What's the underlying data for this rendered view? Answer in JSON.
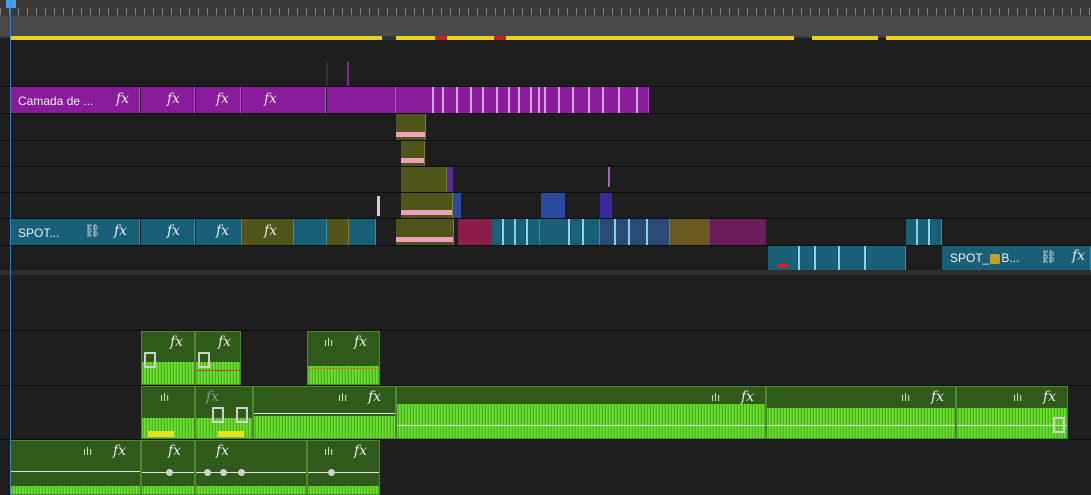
{
  "timeline": {
    "clips": {
      "purple_layer_label": "Camada de ...",
      "teal_spot_label": "SPOT...",
      "teal_spot_right_label": "SPOT_",
      "teal_spot_right_suffix": "B...",
      "fx_symbol": "fx",
      "link_symbol": "⛓",
      "audio_wave_symbol": "ılı"
    },
    "colors": {
      "video_purple": "#8a1b9c",
      "video_teal": "#1a5f78",
      "video_olive": "#4f5418",
      "audio_green": "#5fd12a",
      "work_area": "#e8d21a",
      "marker_red": "#c0241e",
      "playhead_blue": "#3a8fd8"
    }
  }
}
